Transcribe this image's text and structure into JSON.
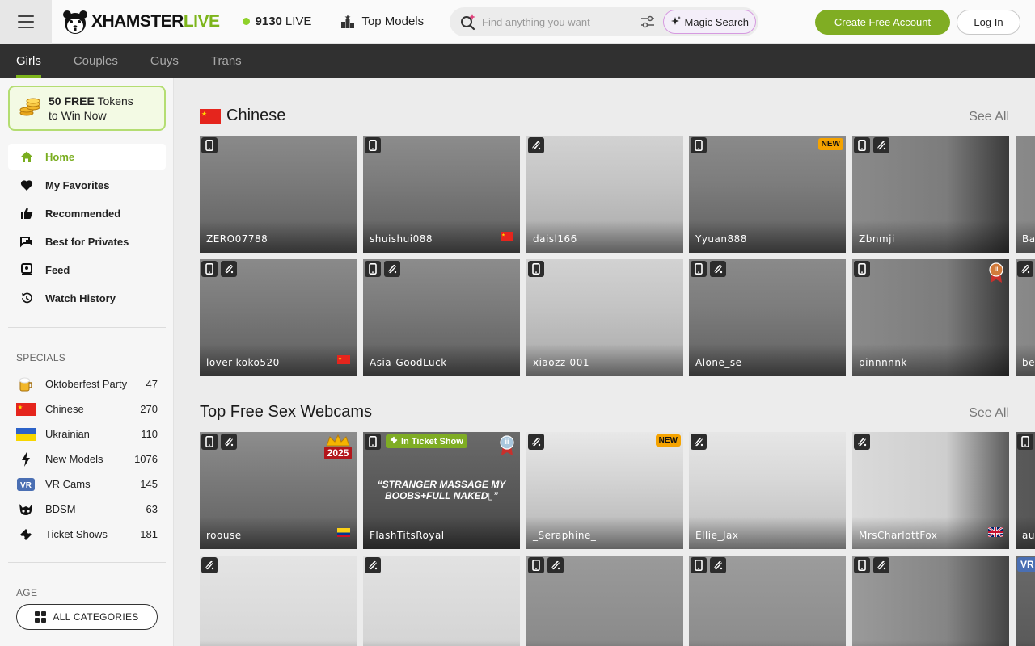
{
  "header": {
    "logo_xh": "XHAMSTER",
    "logo_live": "LIVE",
    "live_count": "9130",
    "live_label": "LIVE",
    "top_models": "Top Models",
    "search_placeholder": "Find anything you want",
    "magic_search": "Magic Search",
    "create_account": "Create Free Account",
    "login": "Log In"
  },
  "categories": [
    "Girls",
    "Couples",
    "Guys",
    "Trans"
  ],
  "sidebar": {
    "promo_bold": "50 FREE",
    "promo_rest": " Tokens",
    "promo_line2": "to Win Now",
    "nav": [
      {
        "label": "Home",
        "icon": "home-icon"
      },
      {
        "label": "My Favorites",
        "icon": "heart-icon"
      },
      {
        "label": "Recommended",
        "icon": "thumbs-up-icon"
      },
      {
        "label": "Best for Privates",
        "icon": "chat-icon"
      },
      {
        "label": "Feed",
        "icon": "feed-icon"
      },
      {
        "label": "Watch History",
        "icon": "history-icon"
      }
    ],
    "specials_label": "SPECIALS",
    "specials": [
      {
        "label": "Oktoberfest Party",
        "count": "47",
        "icon": "beer-icon"
      },
      {
        "label": "Chinese",
        "count": "270",
        "icon": "china-flag-icon"
      },
      {
        "label": "Ukrainian",
        "count": "110",
        "icon": "ukraine-flag-icon"
      },
      {
        "label": "New Models",
        "count": "1076",
        "icon": "lightning-icon"
      },
      {
        "label": "VR Cams",
        "count": "145",
        "icon": "vr-icon"
      },
      {
        "label": "BDSM",
        "count": "63",
        "icon": "bdsm-icon"
      },
      {
        "label": "Ticket Shows",
        "count": "181",
        "icon": "ticket-icon"
      }
    ],
    "age_label": "AGE",
    "all_categories": "ALL CATEGORIES"
  },
  "sections": [
    {
      "title": "Chinese",
      "see_all": "See All",
      "rows": [
        [
          {
            "name": "ZERO07788",
            "badges": [
              "mobile"
            ]
          },
          {
            "name": "shuishui088",
            "badges": [
              "mobile"
            ],
            "flag": "cn"
          },
          {
            "name": "daisl166",
            "badges": [
              "interactive"
            ]
          },
          {
            "name": "Yyuan888",
            "badges": [
              "mobile"
            ],
            "new": "NEW"
          },
          {
            "name": "Zbnmji",
            "badges": [
              "mobile",
              "interactive"
            ]
          },
          {
            "name": "Ba",
            "badges": []
          }
        ],
        [
          {
            "name": "lover-koko520",
            "badges": [
              "mobile",
              "interactive"
            ],
            "flag": "cn"
          },
          {
            "name": "Asia-GoodLuck",
            "badges": [
              "mobile",
              "interactive"
            ]
          },
          {
            "name": "xiaozz-001",
            "badges": [
              "mobile"
            ]
          },
          {
            "name": "Alone_se",
            "badges": [
              "mobile",
              "interactive"
            ]
          },
          {
            "name": "pinnnnnk",
            "badges": [
              "mobile"
            ],
            "medal": "ii"
          },
          {
            "name": "be",
            "badges": [
              "interactive"
            ]
          }
        ]
      ]
    },
    {
      "title": "Top Free Sex Webcams",
      "see_all": "See All",
      "rows": [
        [
          {
            "name": "roouse",
            "badges": [
              "mobile",
              "interactive"
            ],
            "crown": "2025",
            "flag": "co"
          },
          {
            "name": "FlashTitsRoyal",
            "badges": [
              "mobile"
            ],
            "ticket": "In Ticket Show",
            "topic": "“STRANGER MASSAGE MY BOOBS+FULL NAKED▯”",
            "medal": "ii"
          },
          {
            "name": "_Seraphine_",
            "badges": [
              "interactive"
            ],
            "new": "NEW"
          },
          {
            "name": "Ellie_Jax",
            "badges": [
              "interactive"
            ]
          },
          {
            "name": "MrsCharlottFox",
            "badges": [
              "interactive"
            ],
            "flag": "gb"
          },
          {
            "name": "au",
            "badges": [
              "mobile"
            ]
          }
        ],
        [
          {
            "name": "",
            "badges": [
              "interactive"
            ]
          },
          {
            "name": "",
            "badges": [
              "interactive"
            ]
          },
          {
            "name": "",
            "badges": [
              "mobile",
              "interactive"
            ]
          },
          {
            "name": "",
            "badges": [
              "mobile",
              "interactive"
            ]
          },
          {
            "name": "",
            "badges": [
              "mobile",
              "interactive"
            ]
          },
          {
            "name": "",
            "badges": [],
            "vr": "VR"
          }
        ]
      ]
    }
  ],
  "colors": {
    "accent": "#7db51b",
    "button_green": "#80ad23",
    "nav_dark": "#303030",
    "new_badge": "#f5a300"
  }
}
